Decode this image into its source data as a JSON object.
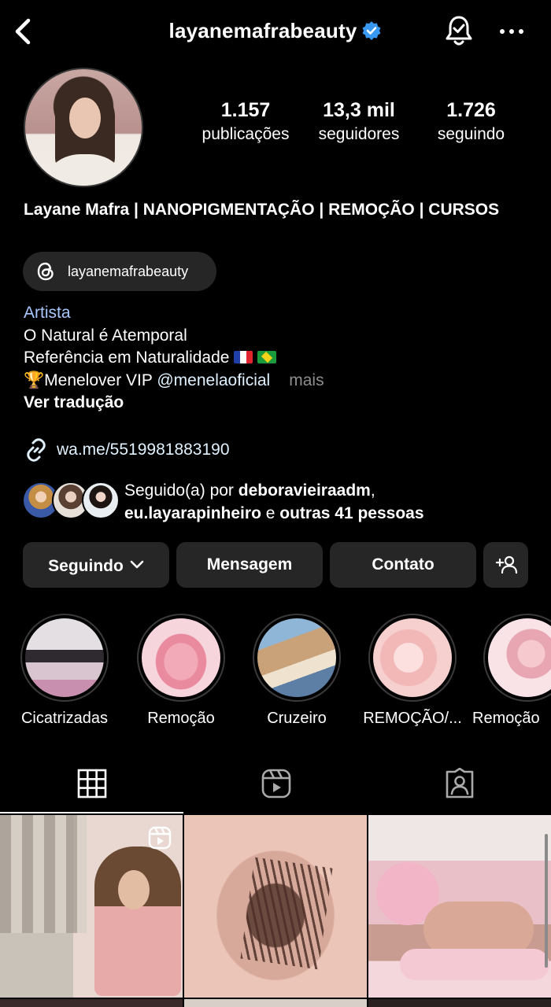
{
  "header": {
    "username": "layanemafrabeauty",
    "verified": true
  },
  "profile": {
    "stats": [
      {
        "value": "1.157",
        "label": "publicações"
      },
      {
        "value": "13,3 mil",
        "label": "seguidores"
      },
      {
        "value": "1.726",
        "label": "seguindo"
      }
    ],
    "full_name": "Layane Mafra | NANOPIGMENTAÇÃO | REMOÇÃO | CURSOS",
    "threads_handle": "layanemafrabeauty",
    "category": "Artista",
    "bio_lines": [
      "O Natural é Atemporal",
      "Referência em Naturalidade"
    ],
    "bio_trophy": "🏆",
    "bio_vip_text": "Menelover VIP ",
    "bio_mention": "@menelaoficial",
    "more_label": "mais",
    "translate_label": "Ver tradução",
    "link": "wa.me/5519981883190",
    "followed_by": {
      "prefix": "Seguido(a) por ",
      "user1": "deboravieiraadm",
      "sep1": ",",
      "user2": "eu.layarapinheiro",
      "conj": " e ",
      "others": "outras 41 pessoas"
    }
  },
  "actions": {
    "following_label": "Seguindo",
    "message_label": "Mensagem",
    "contact_label": "Contato"
  },
  "highlights": [
    {
      "label": "Cicatrizadas"
    },
    {
      "label": "Remoção"
    },
    {
      "label": "Cruzeiro"
    },
    {
      "label": "REMOÇÃO/..."
    },
    {
      "label": "Remoção"
    }
  ],
  "tabs": [
    {
      "name": "grid-icon",
      "active": true
    },
    {
      "name": "reels-icon",
      "active": false
    },
    {
      "name": "tagged-icon",
      "active": false
    }
  ],
  "colors": {
    "background": "#000000",
    "button_bg": "#262626",
    "link": "#e0f1ff",
    "category": "#a8c7ff",
    "verified": "#3897f0",
    "muted": "#8e8e8e"
  }
}
